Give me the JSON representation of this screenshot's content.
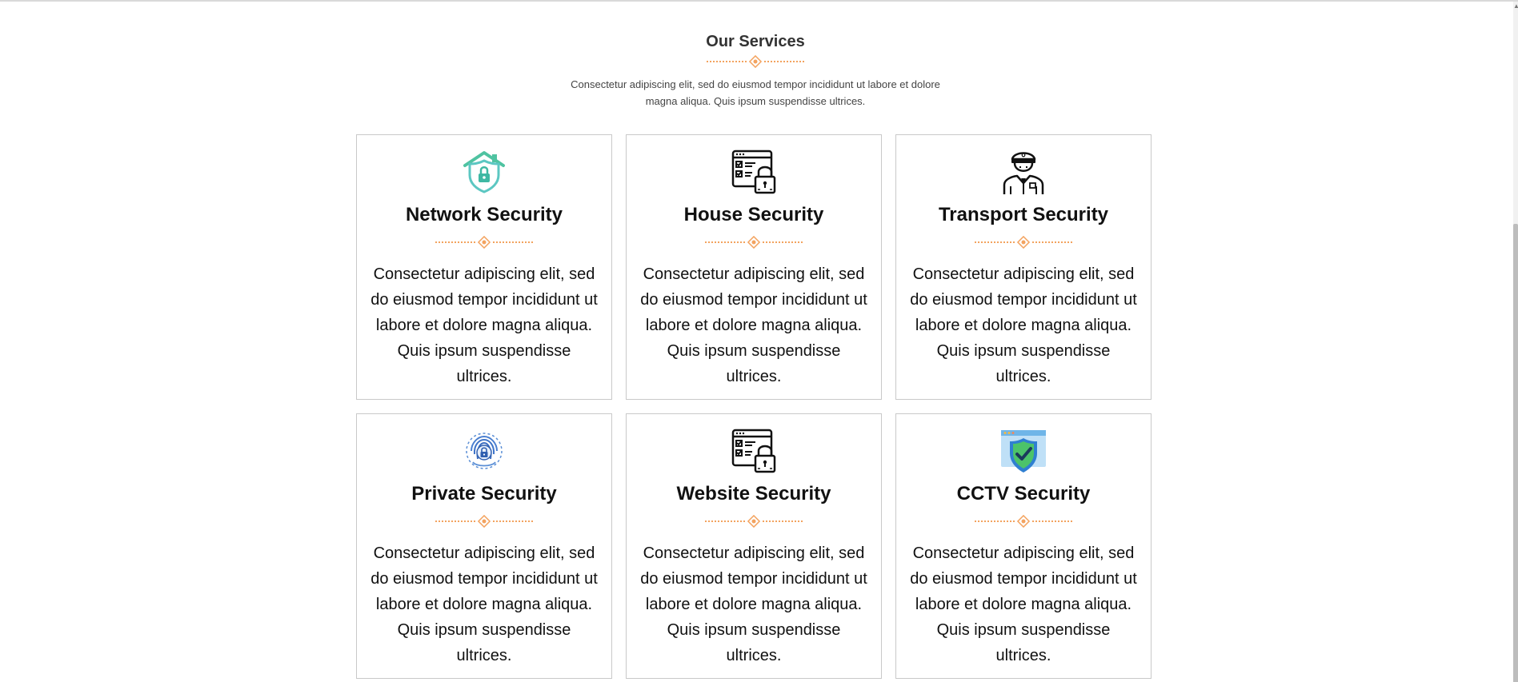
{
  "section": {
    "title": "Our Services",
    "description": "Consectetur adipiscing elit, sed do eiusmod tempor incididunt ut labore et dolore magna aliqua. Quis ipsum suspendisse ultrices."
  },
  "colors": {
    "accent": "#f3a35f",
    "card_border": "#c9c9c9",
    "title_text": "#333333"
  },
  "services": [
    {
      "title": "Network Security",
      "icon": "house-shield-lock-icon",
      "text": "Consectetur adipiscing elit, sed do eiusmod tempor incididunt ut labore et dolore magna aliqua. Quis ipsum suspendisse ultrices."
    },
    {
      "title": "House Security",
      "icon": "checklist-lock-icon",
      "text": "Consectetur adipiscing elit, sed do eiusmod tempor incididunt ut labore et dolore magna aliqua. Quis ipsum suspendisse ultrices."
    },
    {
      "title": "Transport Security",
      "icon": "security-guard-icon",
      "text": "Consectetur adipiscing elit, sed do eiusmod tempor incididunt ut labore et dolore magna aliqua. Quis ipsum suspendisse ultrices."
    },
    {
      "title": "Private Security",
      "icon": "fingerprint-lock-icon",
      "text": "Consectetur adipiscing elit, sed do eiusmod tempor incididunt ut labore et dolore magna aliqua. Quis ipsum suspendisse ultrices."
    },
    {
      "title": "Website Security",
      "icon": "checklist-lock-icon",
      "text": "Consectetur adipiscing elit, sed do eiusmod tempor incididunt ut labore et dolore magna aliqua. Quis ipsum suspendisse ultrices."
    },
    {
      "title": "CCTV Security",
      "icon": "browser-shield-check-icon",
      "text": "Consectetur adipiscing elit, sed do eiusmod tempor incididunt ut labore et dolore magna aliqua. Quis ipsum suspendisse ultrices."
    }
  ]
}
